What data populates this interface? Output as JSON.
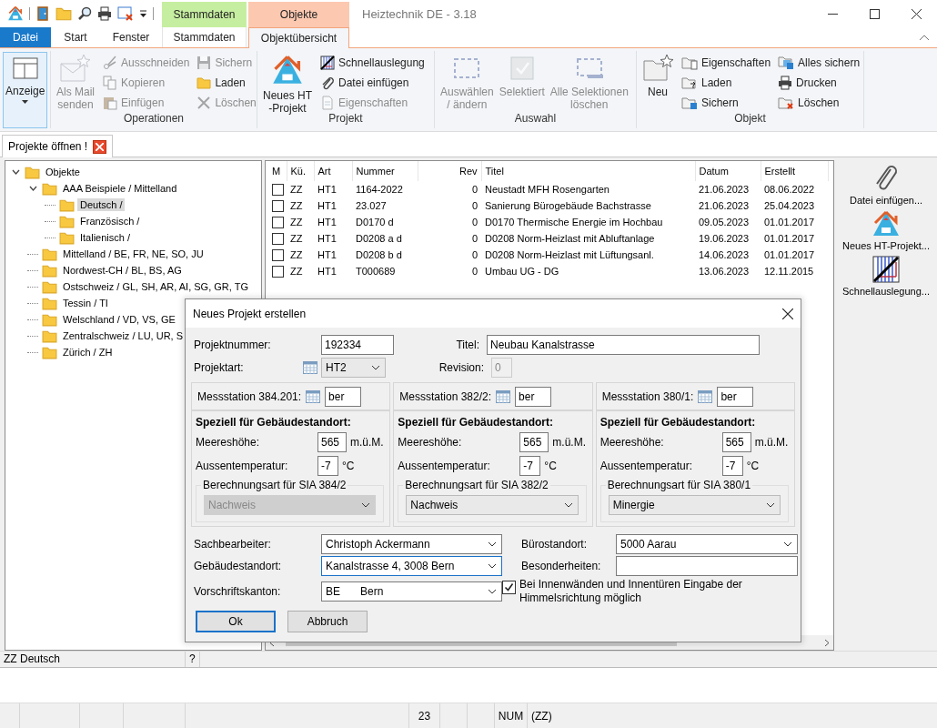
{
  "title_bar": {
    "context_groups": [
      {
        "label": "Stammdaten",
        "color": "#c6eea0"
      },
      {
        "label": "Objekte",
        "color": "#fcc8b0"
      }
    ],
    "title": "Heiztechnik DE - 3.18"
  },
  "ribbon_tabs": [
    {
      "label": "Datei",
      "kind": "file",
      "selected": false
    },
    {
      "label": "Start",
      "kind": "normal",
      "selected": false
    },
    {
      "label": "Fenster",
      "kind": "normal",
      "selected": false
    },
    {
      "label": "Stammdaten",
      "kind": "context",
      "selected": false
    },
    {
      "label": "Objektübersicht",
      "kind": "context",
      "selected": true
    }
  ],
  "ribbon_groups": [
    {
      "items": [
        {
          "label": "Anzeige",
          "kind": "large",
          "dropdown": true,
          "checked": true,
          "disabled": false
        }
      ]
    },
    {
      "label": "Operationen",
      "items": [
        {
          "label": "Als Mail\nsenden",
          "kind": "large",
          "disabled": true
        },
        {
          "label": "Ausschneiden",
          "kind": "small",
          "disabled": true
        },
        {
          "label": "Kopieren",
          "kind": "small",
          "disabled": true
        },
        {
          "label": "Einfügen",
          "kind": "small",
          "disabled": true
        },
        {
          "label": "Sichern",
          "kind": "small",
          "disabled": true
        },
        {
          "label": "Laden",
          "kind": "small",
          "disabled": false
        },
        {
          "label": "Löschen",
          "kind": "small",
          "disabled": true
        }
      ]
    },
    {
      "label": "Projekt",
      "items": [
        {
          "label": "Neues HT\n-Projekt",
          "kind": "large",
          "disabled": false
        },
        {
          "label": "Schnellauslegung",
          "kind": "small",
          "disabled": false
        },
        {
          "label": "Datei einfügen",
          "kind": "small",
          "disabled": false
        },
        {
          "label": "Eigenschaften",
          "kind": "small",
          "disabled": true
        }
      ]
    },
    {
      "label": "Auswahl",
      "items": [
        {
          "label": "Auswählen\n/ ändern",
          "kind": "large",
          "disabled": true
        },
        {
          "label": "Selektiert",
          "kind": "large",
          "disabled": true
        },
        {
          "label": "Alle Selektionen\nlöschen",
          "kind": "large",
          "disabled": true
        }
      ]
    },
    {
      "label": "Objekt",
      "items": [
        {
          "label": "Neu",
          "kind": "large",
          "disabled": false
        },
        {
          "label": "Eigenschaften",
          "kind": "small",
          "disabled": false
        },
        {
          "label": "Laden",
          "kind": "small",
          "disabled": false
        },
        {
          "label": "Sichern",
          "kind": "small",
          "disabled": false
        },
        {
          "label": "Alles sichern",
          "kind": "small",
          "disabled": false
        },
        {
          "label": "Drucken",
          "kind": "small",
          "disabled": false
        },
        {
          "label": "Löschen",
          "kind": "small",
          "disabled": false
        }
      ]
    }
  ],
  "document_tab": {
    "label": "Projekte öffnen !"
  },
  "tree": [
    {
      "label": "Objekte",
      "expanded": true,
      "selected": false,
      "children": [
        {
          "label": "AAA Beispiele / Mittelland",
          "expanded": true,
          "selected": false,
          "children": [
            {
              "label": "Deutsch /",
              "selected": true
            },
            {
              "label": "Französisch /",
              "selected": false
            },
            {
              "label": "Italienisch /",
              "selected": false
            }
          ]
        },
        {
          "label": "Mittelland / BE, FR, NE, SO, JU",
          "selected": false
        },
        {
          "label": "Nordwest-CH / BL, BS, AG",
          "selected": false
        },
        {
          "label": "Ostschweiz / GL, SH, AR, AI, SG, GR, TG",
          "selected": false
        },
        {
          "label": "Tessin / TI",
          "selected": false
        },
        {
          "label": "Welschland / VD, VS, GE",
          "selected": false
        },
        {
          "label": "Zentralschweiz / LU, UR, S",
          "selected": false
        },
        {
          "label": "Zürich / ZH",
          "selected": false
        }
      ]
    }
  ],
  "table": {
    "columns": [
      "M",
      "Kü.",
      "Art",
      "Nummer",
      "Rev",
      "Titel",
      "Datum",
      "Erstellt"
    ],
    "rows": [
      {
        "checked": false,
        "cells": [
          "",
          "ZZ",
          "HT1",
          "1164-2022",
          "0",
          "Neustadt MFH Rosengarten",
          "21.06.2023",
          "08.06.2022"
        ]
      },
      {
        "checked": false,
        "cells": [
          "",
          "ZZ",
          "HT1",
          "23.027",
          "0",
          "Sanierung Bürogebäude Bachstrasse",
          "21.06.2023",
          "25.04.2023"
        ]
      },
      {
        "checked": false,
        "cells": [
          "",
          "ZZ",
          "HT1",
          "D0170 d",
          "0",
          "D0170 Thermische Energie im Hochbau",
          "09.05.2023",
          "01.01.2017"
        ]
      },
      {
        "checked": false,
        "cells": [
          "",
          "ZZ",
          "HT1",
          "D0208 a d",
          "0",
          "D0208 Norm-Heizlast mit Abluftanlage",
          "19.06.2023",
          "01.01.2017"
        ]
      },
      {
        "checked": false,
        "cells": [
          "",
          "ZZ",
          "HT1",
          "D0208 b d",
          "0",
          "D0208 Norm-Heizlast mit Lüftungsanl.",
          "14.06.2023",
          "01.01.2017"
        ]
      },
      {
        "checked": false,
        "cells": [
          "",
          "ZZ",
          "HT1",
          "T000689",
          "0",
          "Umbau UG - DG",
          "13.06.2023",
          "12.11.2015"
        ]
      }
    ]
  },
  "side_tools": [
    {
      "label": "Datei einfügen..."
    },
    {
      "label": "Neues HT-Projekt..."
    },
    {
      "label": "Schnellauslegung..."
    }
  ],
  "status_row": [
    "ZZ Deutsch",
    "?"
  ],
  "status_bar": [
    "23",
    "NUM",
    "(ZZ)"
  ],
  "dialog": {
    "title": "Neues Projekt erstellen",
    "project_number": {
      "label": "Projektnummer:",
      "value": "192334"
    },
    "title_field": {
      "label": "Titel:",
      "value": "Neubau Kanalstrasse"
    },
    "project_type": {
      "label": "Projektart:",
      "value": "HT2"
    },
    "revision": {
      "label": "Revision:",
      "value": "0",
      "disabled": true
    },
    "stations": [
      {
        "label": "Messstation 384.201:",
        "value": "ber",
        "heading": "Speziell für Gebäudestandort:",
        "altitude_label": "Meereshöhe:",
        "altitude": "565",
        "altitude_unit": "m.ü.M.",
        "temperature_label": "Aussentemperatur:",
        "temperature": "-7",
        "temperature_unit": "°C",
        "method_label": "Berechnungsart für SIA 384/2",
        "method": "Nachweis",
        "disabled": true
      },
      {
        "label": "Messstation 382/2:",
        "value": "ber",
        "heading": "Speziell für Gebäudestandort:",
        "altitude_label": "Meereshöhe:",
        "altitude": "565",
        "altitude_unit": "m.ü.M.",
        "temperature_label": "Aussentemperatur:",
        "temperature": "-7",
        "temperature_unit": "°C",
        "method_label": "Berechnungsart für SIA 382/2",
        "method": "Nachweis",
        "disabled": false
      },
      {
        "label": "Messstation 380/1:",
        "value": "ber",
        "heading": "Speziell für Gebäudestandort:",
        "altitude_label": "Meereshöhe:",
        "altitude": "565",
        "altitude_unit": "m.ü.M.",
        "temperature_label": "Aussentemperatur:",
        "temperature": "-7",
        "temperature_unit": "°C",
        "method_label": "Berechnungsart für SIA 380/1",
        "method": "Minergie",
        "disabled": false
      }
    ],
    "left_fields": [
      {
        "label": "Sachbearbeiter:",
        "value": "Christoph Ackermann",
        "focused": false
      },
      {
        "label": "Gebäudestandort:",
        "value": "Kanalstrasse 4, 3008 Bern",
        "focused": true
      },
      {
        "label": "Vorschriftskanton:",
        "value": "BE",
        "detail": "Bern",
        "focused": false
      }
    ],
    "right_fields": [
      {
        "label": "Bürostandort:",
        "kind": "dropdown",
        "value": "5000 Aarau"
      },
      {
        "label": "Besonderheiten:",
        "kind": "text"
      }
    ],
    "checkbox": {
      "label": "Bei Innenwänden und Innentüren Eingabe der Himmelsrichtung möglich",
      "checked": true
    },
    "buttons": [
      {
        "label": "Ok",
        "default": true
      },
      {
        "label": "Abbruch",
        "default": false
      }
    ]
  }
}
